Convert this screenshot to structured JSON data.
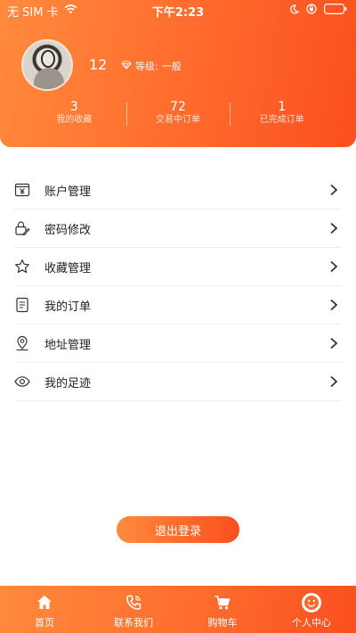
{
  "status_bar": {
    "carrier": "无 SIM 卡",
    "time": "下午2:23"
  },
  "profile": {
    "username": "12",
    "level_label": "等级:",
    "level_value": "一般",
    "stats": [
      {
        "value": "3",
        "label": "我的收藏"
      },
      {
        "value": "72",
        "label": "交易中订单"
      },
      {
        "value": "1",
        "label": "已完成订单"
      }
    ]
  },
  "menu": [
    {
      "label": "账户管理",
      "icon": "wallet-icon"
    },
    {
      "label": "密码修改",
      "icon": "lock-edit-icon"
    },
    {
      "label": "收藏管理",
      "icon": "star-icon"
    },
    {
      "label": "我的订单",
      "icon": "document-icon"
    },
    {
      "label": "地址管理",
      "icon": "location-pin-icon"
    },
    {
      "label": "我的足迹",
      "icon": "eye-icon"
    }
  ],
  "logout_label": "退出登录",
  "tabbar": [
    {
      "label": "首页",
      "icon": "home-icon"
    },
    {
      "label": "联系我们",
      "icon": "phone-icon"
    },
    {
      "label": "购物车",
      "icon": "cart-icon"
    },
    {
      "label": "个人中心",
      "icon": "smiley-icon",
      "active": true
    }
  ],
  "colors": {
    "accent_start": "#ff8a3d",
    "accent_end": "#fb4f1f"
  }
}
